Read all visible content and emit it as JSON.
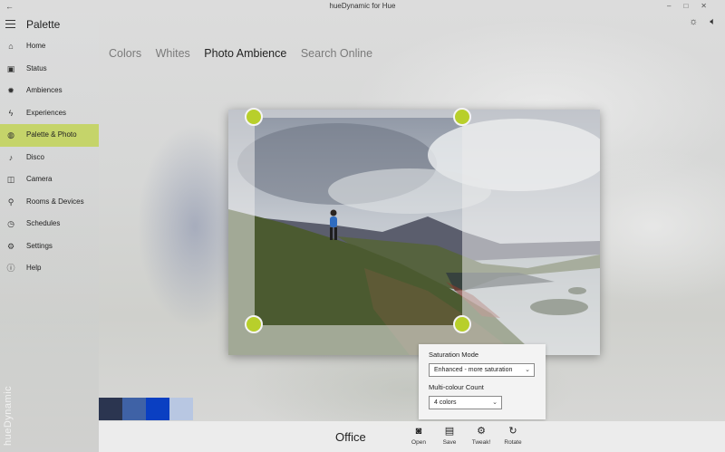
{
  "window": {
    "title": "hueDynamic for Hue",
    "back_glyph": "←"
  },
  "app": {
    "title": "Palette",
    "brand_vertical": "hueDynamic"
  },
  "sidebar": {
    "items": [
      {
        "label": "Home",
        "icon": "home-icon",
        "glyph": "⌂",
        "active": false
      },
      {
        "label": "Status",
        "icon": "status-icon",
        "glyph": "▣",
        "active": false
      },
      {
        "label": "Ambiences",
        "icon": "sun-icon",
        "glyph": "✹",
        "active": false
      },
      {
        "label": "Experiences",
        "icon": "lightning-icon",
        "glyph": "ϟ",
        "active": false
      },
      {
        "label": "Palette & Photo",
        "icon": "palette-icon",
        "glyph": "◍",
        "active": true
      },
      {
        "label": "Disco",
        "icon": "music-note-icon",
        "glyph": "♪",
        "active": false
      },
      {
        "label": "Camera",
        "icon": "camera-icon",
        "glyph": "◫",
        "active": false
      },
      {
        "label": "Rooms & Devices",
        "icon": "bulb-icon",
        "glyph": "⚲",
        "active": false
      },
      {
        "label": "Schedules",
        "icon": "clock-icon",
        "glyph": "◷",
        "active": false
      },
      {
        "label": "Settings",
        "icon": "gear-icon",
        "glyph": "⚙",
        "active": false
      },
      {
        "label": "Help",
        "icon": "info-icon",
        "glyph": "ⓘ",
        "active": false
      }
    ]
  },
  "top_icons": {
    "brightness": "☼",
    "volume": "🔈︎"
  },
  "tabs": [
    {
      "label": "Colors",
      "active": false
    },
    {
      "label": "Whites",
      "active": false
    },
    {
      "label": "Photo Ambience",
      "active": true
    },
    {
      "label": "Search Online",
      "active": false
    }
  ],
  "accent_color": "#c5d46a",
  "handle_color": "#b8cf2b",
  "swatches": [
    "#2b3550",
    "#3f62a6",
    "#0a3fc2",
    "#b8c7e2"
  ],
  "popup": {
    "saturation_label": "Saturation Mode",
    "saturation_value": "Enhanced - more saturation",
    "count_label": "Multi-colour Count",
    "count_value": "4 colors"
  },
  "bottom": {
    "scene_name": "Office",
    "tools": [
      {
        "label": "Open",
        "icon": "open-icon",
        "glyph": "◙"
      },
      {
        "label": "Save",
        "icon": "save-icon",
        "glyph": "▤"
      },
      {
        "label": "Tweak!",
        "icon": "tweak-gear-icon",
        "glyph": "⚙"
      },
      {
        "label": "Rotate",
        "icon": "rotate-icon",
        "glyph": "↻"
      }
    ]
  }
}
